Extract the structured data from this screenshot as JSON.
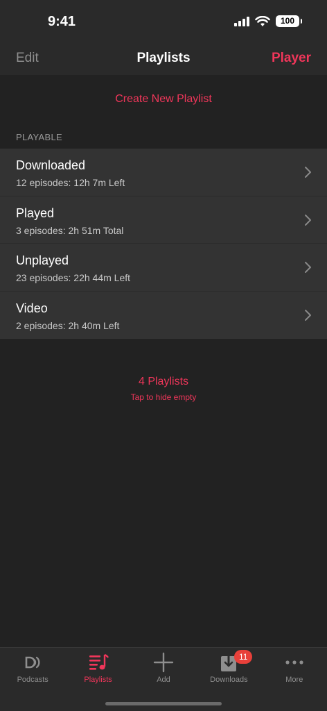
{
  "status": {
    "time": "9:41",
    "battery": "100"
  },
  "nav": {
    "edit_label": "Edit",
    "title": "Playlists",
    "player_label": "Player"
  },
  "create_label": "Create New Playlist",
  "section_title": "PLAYABLE",
  "playlists": [
    {
      "title": "Downloaded",
      "subtitle": "12 episodes: 12h 7m Left"
    },
    {
      "title": "Played",
      "subtitle": "3 episodes: 2h 51m Total"
    },
    {
      "title": "Unplayed",
      "subtitle": "23 episodes: 22h 44m Left"
    },
    {
      "title": "Video",
      "subtitle": "2 episodes: 2h 40m Left"
    }
  ],
  "summary": {
    "count": "4 Playlists",
    "hint": "Tap to hide empty"
  },
  "tabs": [
    {
      "label": "Podcasts",
      "icon": "podcasts-icon"
    },
    {
      "label": "Playlists",
      "icon": "playlists-icon",
      "active": true
    },
    {
      "label": "Add",
      "icon": "add-icon"
    },
    {
      "label": "Downloads",
      "icon": "downloads-icon",
      "badge": "11"
    },
    {
      "label": "More",
      "icon": "more-icon"
    }
  ],
  "colors": {
    "accent": "#f0365a",
    "background": "#222222",
    "list_bg": "#333333",
    "badge": "#e8403a"
  }
}
